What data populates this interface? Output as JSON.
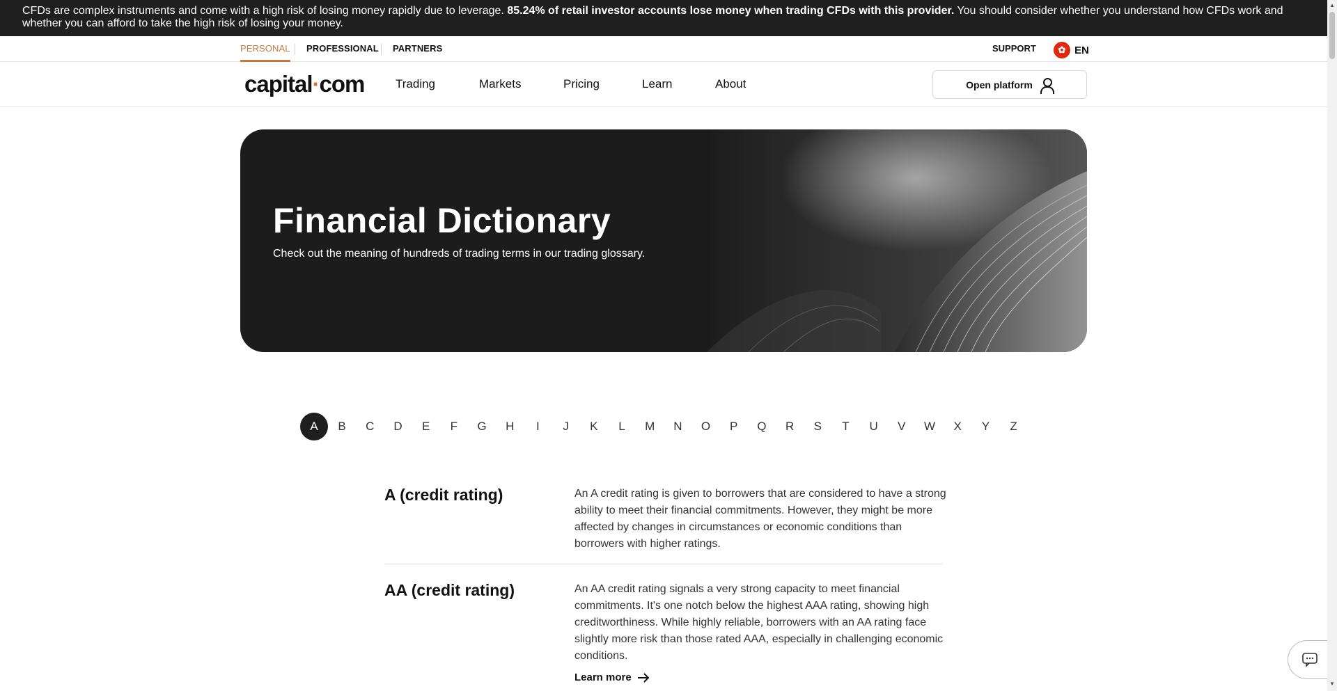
{
  "risk_warning": {
    "text_before": "CFDs are complex instruments and come with a high risk of losing money rapidly due to leverage. ",
    "bold": "85.24% of retail investor accounts lose money when trading CFDs with this provider.",
    "text_after": " You should consider whether you understand how CFDs work and whether you can afford to take the high risk of losing your money."
  },
  "top_nav": {
    "segments": [
      "PERSONAL",
      "PROFESSIONAL",
      "PARTNERS"
    ],
    "active_segment": "PERSONAL",
    "support_label": "SUPPORT",
    "language": "EN",
    "language_icon": "hong-kong-flag-icon"
  },
  "main_nav": {
    "logo": {
      "left": "capital",
      "dot": "·",
      "right": "com"
    },
    "items": [
      "Trading",
      "Markets",
      "Pricing",
      "Learn",
      "About"
    ],
    "open_platform_label": "Open platform",
    "open_platform_icon": "user-icon"
  },
  "hero": {
    "title": "Financial Dictionary",
    "subtitle": "Check out the meaning of hundreds of trading terms in our trading glossary."
  },
  "alphabet": {
    "letters": [
      "A",
      "B",
      "C",
      "D",
      "E",
      "F",
      "G",
      "H",
      "I",
      "J",
      "K",
      "L",
      "M",
      "N",
      "O",
      "P",
      "Q",
      "R",
      "S",
      "T",
      "U",
      "V",
      "W",
      "X",
      "Y",
      "Z"
    ],
    "active": "A"
  },
  "entries": [
    {
      "term": "A (credit rating)",
      "definition": "An A credit rating is given to borrowers that are considered to have a strong ability to meet their financial commitments. However, they might be more affected by changes in circumstances or economic conditions than borrowers with higher ratings."
    },
    {
      "term": "AA (credit rating)",
      "definition": "An AA credit rating signals a very strong capacity to meet financial commitments. It's one notch below the highest AAA rating, showing high creditworthiness. While highly reliable, borrowers with an AA rating face slightly more risk than those rated AAA, especially in challenging economic conditions."
    }
  ],
  "learn_more_label": "Learn more",
  "chat_icon": "chat-icon",
  "colors": {
    "accent": "#c8793e",
    "dark": "#1f1f1f"
  }
}
